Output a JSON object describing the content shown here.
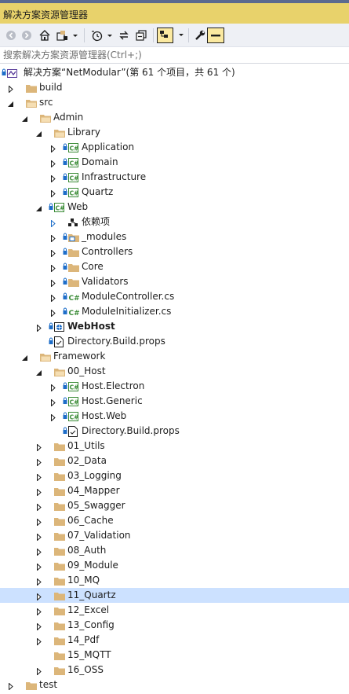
{
  "window": {
    "title": "解决方案资源管理器"
  },
  "toolbar": {
    "buttons": [
      {
        "name": "back-button",
        "icon": "back-arrow-icon"
      },
      {
        "name": "forward-button",
        "icon": "forward-arrow-icon"
      },
      {
        "name": "home-button",
        "icon": "home-icon"
      },
      {
        "name": "switch-views-button",
        "icon": "switch-views-icon"
      },
      {
        "name": "pending-changes-filter-button",
        "icon": "clock-icon"
      },
      {
        "name": "sync-button",
        "icon": "sync-arrows-icon"
      },
      {
        "name": "collapse-all-button",
        "icon": "collapse-all-icon"
      },
      {
        "name": "show-all-files-button",
        "icon": "show-all-files-icon"
      },
      {
        "name": "properties-button",
        "icon": "wrench-icon"
      },
      {
        "name": "preview-button",
        "icon": "preview-icon"
      }
    ]
  },
  "search": {
    "placeholder": "搜索解决方案资源管理器(Ctrl+;)"
  },
  "colors": {
    "accent": "#cce1ff",
    "title_bg": "#e8d26b",
    "folder": "#dcb67a",
    "csharp": "#388a34",
    "arrow": "#1e1e1e"
  },
  "tree": [
    {
      "label": "解决方案“NetModular”(第 61 个项目，共 61 个)",
      "icon": "solution-icon",
      "level": 0,
      "expander": "none"
    },
    {
      "label": "build",
      "icon": "folder-icon",
      "level": 1,
      "expander": "collapsed"
    },
    {
      "label": "src",
      "icon": "folder-open-icon",
      "level": 1,
      "expander": "expanded"
    },
    {
      "label": "Admin",
      "icon": "folder-open-icon",
      "level": 2,
      "expander": "expanded"
    },
    {
      "label": "Library",
      "icon": "folder-open-icon",
      "level": 3,
      "expander": "expanded"
    },
    {
      "label": "Application",
      "icon": "csharp-project-icon",
      "level": 4,
      "expander": "collapsed"
    },
    {
      "label": "Domain",
      "icon": "csharp-project-icon",
      "level": 4,
      "expander": "collapsed"
    },
    {
      "label": "Infrastructure",
      "icon": "csharp-project-icon",
      "level": 4,
      "expander": "collapsed"
    },
    {
      "label": "Quartz",
      "icon": "csharp-project-icon",
      "level": 4,
      "expander": "collapsed"
    },
    {
      "label": "Web",
      "icon": "csharp-project-icon",
      "level": 3,
      "expander": "expanded"
    },
    {
      "label": "依赖项",
      "icon": "dependencies-icon",
      "level": 4,
      "expander": "collapsed-blue"
    },
    {
      "label": "_modules",
      "icon": "module-folder-icon",
      "level": 4,
      "expander": "collapsed"
    },
    {
      "label": "Controllers",
      "icon": "folder-icon",
      "level": 4,
      "expander": "collapsed"
    },
    {
      "label": "Core",
      "icon": "folder-icon",
      "level": 4,
      "expander": "collapsed"
    },
    {
      "label": "Validators",
      "icon": "folder-icon",
      "level": 4,
      "expander": "collapsed"
    },
    {
      "label": "ModuleController.cs",
      "icon": "csharp-file-icon",
      "level": 4,
      "expander": "collapsed"
    },
    {
      "label": "ModuleInitializer.cs",
      "icon": "csharp-file-icon",
      "level": 4,
      "expander": "collapsed"
    },
    {
      "label": "WebHost",
      "icon": "web-project-icon",
      "level": 3,
      "expander": "collapsed",
      "bold": true
    },
    {
      "label": "Directory.Build.props",
      "icon": "props-file-icon",
      "level": 3,
      "expander": "none"
    },
    {
      "label": "Framework",
      "icon": "folder-open-icon",
      "level": 2,
      "expander": "expanded"
    },
    {
      "label": "00_Host",
      "icon": "folder-open-icon",
      "level": 3,
      "expander": "expanded"
    },
    {
      "label": "Host.Electron",
      "icon": "csharp-project-icon",
      "level": 4,
      "expander": "collapsed"
    },
    {
      "label": "Host.Generic",
      "icon": "csharp-project-icon",
      "level": 4,
      "expander": "collapsed"
    },
    {
      "label": "Host.Web",
      "icon": "csharp-project-icon",
      "level": 4,
      "expander": "collapsed"
    },
    {
      "label": "Directory.Build.props",
      "icon": "props-file-icon",
      "level": 4,
      "expander": "none"
    },
    {
      "label": "01_Utils",
      "icon": "folder-icon",
      "level": 3,
      "expander": "collapsed"
    },
    {
      "label": "02_Data",
      "icon": "folder-icon",
      "level": 3,
      "expander": "collapsed"
    },
    {
      "label": "03_Logging",
      "icon": "folder-icon",
      "level": 3,
      "expander": "collapsed"
    },
    {
      "label": "04_Mapper",
      "icon": "folder-icon",
      "level": 3,
      "expander": "collapsed"
    },
    {
      "label": "05_Swagger",
      "icon": "folder-icon",
      "level": 3,
      "expander": "collapsed"
    },
    {
      "label": "06_Cache",
      "icon": "folder-icon",
      "level": 3,
      "expander": "collapsed"
    },
    {
      "label": "07_Validation",
      "icon": "folder-icon",
      "level": 3,
      "expander": "collapsed"
    },
    {
      "label": "08_Auth",
      "icon": "folder-icon",
      "level": 3,
      "expander": "collapsed"
    },
    {
      "label": "09_Module",
      "icon": "folder-icon",
      "level": 3,
      "expander": "collapsed"
    },
    {
      "label": "10_MQ",
      "icon": "folder-icon",
      "level": 3,
      "expander": "collapsed"
    },
    {
      "label": "11_Quartz",
      "icon": "folder-icon",
      "level": 3,
      "expander": "collapsed",
      "selected": true
    },
    {
      "label": "12_Excel",
      "icon": "folder-icon",
      "level": 3,
      "expander": "collapsed"
    },
    {
      "label": "13_Config",
      "icon": "folder-icon",
      "level": 3,
      "expander": "collapsed"
    },
    {
      "label": "14_Pdf",
      "icon": "folder-icon",
      "level": 3,
      "expander": "collapsed"
    },
    {
      "label": "15_MQTT",
      "icon": "folder-icon",
      "level": 3,
      "expander": "none"
    },
    {
      "label": "16_OSS",
      "icon": "folder-icon",
      "level": 3,
      "expander": "collapsed"
    },
    {
      "label": "test",
      "icon": "folder-icon",
      "level": 1,
      "expander": "collapsed"
    }
  ]
}
